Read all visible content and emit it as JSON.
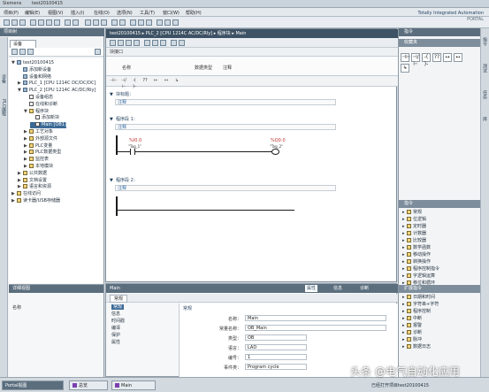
{
  "window": {
    "title_left": "Siemens",
    "title_project": "test20100415"
  },
  "menu": [
    "项目(P)",
    "编辑(E)",
    "视图(V)",
    "插入(I)",
    "在线(O)",
    "选项(N)",
    "工具(T)",
    "窗口(W)",
    "帮助(H)"
  ],
  "brand": {
    "line1": "Totally Integrated Automation",
    "line2": "PORTAL"
  },
  "project_tree": {
    "title": "项目树",
    "tab_devices": "设备",
    "side_labels": [
      "设备",
      "PLC编程"
    ],
    "nodes": [
      {
        "label": "test20100415",
        "indent": 0,
        "exp": "▼",
        "type": "dev"
      },
      {
        "label": "添加新设备",
        "indent": 1,
        "exp": "",
        "type": "dev"
      },
      {
        "label": "设备和网络",
        "indent": 1,
        "exp": "",
        "type": "dev"
      },
      {
        "label": "PLC_1 [CPU 1214C DC/DC/DC]",
        "indent": 1,
        "exp": "▶",
        "type": "dev"
      },
      {
        "label": "PLC_2 [CPU 1214C AC/DC/Rly]",
        "indent": 1,
        "exp": "▼",
        "type": "dev"
      },
      {
        "label": "设备组态",
        "indent": 2,
        "exp": "",
        "type": "blk"
      },
      {
        "label": "在线和诊断",
        "indent": 2,
        "exp": "",
        "type": "blk"
      },
      {
        "label": "程序块",
        "indent": 2,
        "exp": "▼",
        "type": "fld"
      },
      {
        "label": "添加新块",
        "indent": 3,
        "exp": "",
        "type": "blk"
      },
      {
        "label": "Main [OB1]",
        "indent": 3,
        "exp": "",
        "type": "blk",
        "selected": true
      },
      {
        "label": "工艺对象",
        "indent": 2,
        "exp": "▶",
        "type": "fld"
      },
      {
        "label": "外部源文件",
        "indent": 2,
        "exp": "▶",
        "type": "fld"
      },
      {
        "label": "PLC变量",
        "indent": 2,
        "exp": "▶",
        "type": "fld"
      },
      {
        "label": "PLC数据类型",
        "indent": 2,
        "exp": "▶",
        "type": "fld"
      },
      {
        "label": "监控表",
        "indent": 2,
        "exp": "▶",
        "type": "fld"
      },
      {
        "label": "本地模块",
        "indent": 2,
        "exp": "▶",
        "type": "fld"
      },
      {
        "label": "公共数据",
        "indent": 1,
        "exp": "▶",
        "type": "fld"
      },
      {
        "label": "文档设置",
        "indent": 1,
        "exp": "▶",
        "type": "fld"
      },
      {
        "label": "语言和资源",
        "indent": 1,
        "exp": "▶",
        "type": "fld"
      },
      {
        "label": "在线访问",
        "indent": 0,
        "exp": "▶",
        "type": "fld"
      },
      {
        "label": "读卡器/USB存储器",
        "indent": 0,
        "exp": "▶",
        "type": "fld"
      }
    ]
  },
  "details_view": {
    "title": "详细视图",
    "column": "名称"
  },
  "editor": {
    "breadcrumb": "test20100415 ▸ PLC_2 [CPU 1214C AC/DC/Rly] ▸ 程序块 ▸ Main",
    "interface_label": "块接口",
    "columns": [
      "名称",
      "数据类型",
      "注释"
    ],
    "networks": [
      {
        "label": "块标题：",
        "title": "",
        "comment": "注释"
      },
      {
        "label": "程序段 1：",
        "title": "",
        "comment": "注释"
      },
      {
        "label": "程序段 2：",
        "title": "",
        "comment": "注释"
      }
    ],
    "contact1": {
      "addr": "%I0.0",
      "name": "\"Tag_1\""
    },
    "contact2": {
      "addr": "%Q0.0",
      "name": "\"Tag_2\""
    }
  },
  "ladder_buttons": [
    "⊣⊢",
    "⊣/⊢",
    "-( )-",
    "??",
    "↦",
    "↤",
    "↳"
  ],
  "instructions_panel": {
    "title": "指令",
    "favorites": "收藏夹",
    "fav_buttons": [
      "⊣⊢",
      "⊣/⊢",
      "-( )-",
      "??",
      "↦",
      "↤",
      "↳"
    ],
    "instr_header": "指令",
    "items": [
      "常规",
      "位逻辑",
      "定时器",
      "计数器",
      "比较器",
      "数学函数",
      "移动操作",
      "转换操作",
      "程序控制指令",
      "字逻辑运算",
      "移位和循环"
    ],
    "extended_header": "扩展指令",
    "extended": [
      "日期和时间",
      "字符串+字符",
      "程序控制",
      "中断",
      "报警",
      "诊断",
      "脉冲",
      "数据日志"
    ]
  },
  "right_vtabs": [
    "指令",
    "测试",
    "任务",
    "库"
  ],
  "properties": {
    "title": "Main",
    "tabs": [
      "属性",
      "信息",
      "诊断"
    ],
    "subtab": "常规",
    "nav": [
      "常规",
      "信息",
      "时间戳",
      "编译",
      "保护",
      "属性"
    ],
    "section": "常规",
    "fields": [
      {
        "label": "名称：",
        "value": "Main"
      },
      {
        "label": "常量名称：",
        "value": "OB_Main"
      },
      {
        "label": "类型：",
        "value": "OB"
      },
      {
        "label": "语言：",
        "value": "LAD"
      },
      {
        "label": "编号：",
        "value": "1"
      },
      {
        "label": "事件类：",
        "value": "Program cycle"
      }
    ]
  },
  "statusbar": {
    "portal_view": "Portal视图",
    "tab1": "总览",
    "tab2": "Main",
    "status": "已经打开项目test20100415"
  },
  "watermark": "头条 @电气自动化应用"
}
